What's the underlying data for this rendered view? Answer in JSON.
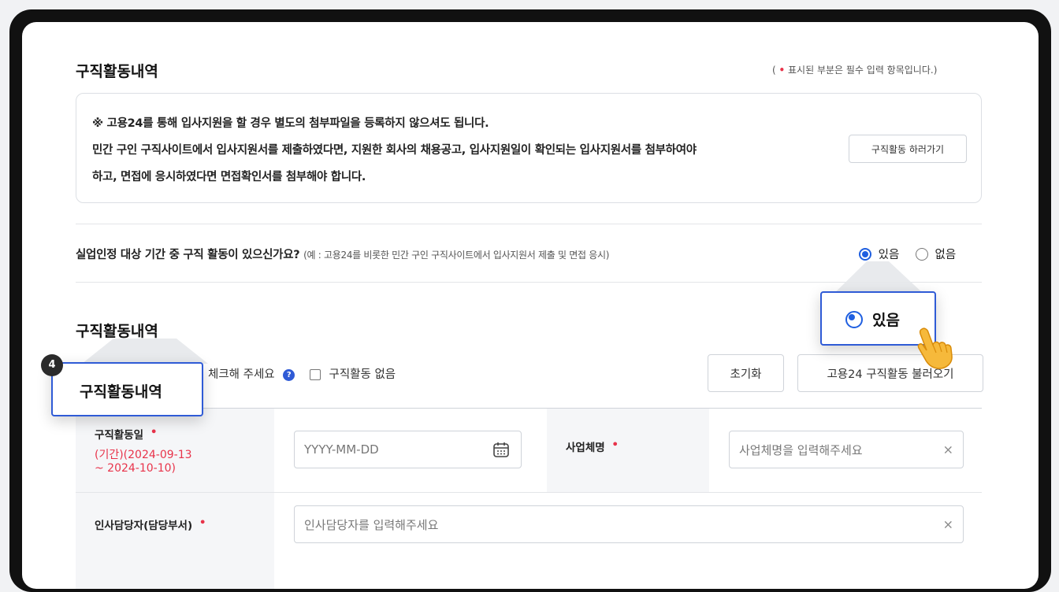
{
  "section": {
    "title": "구직활동내역",
    "required_note_before": "(",
    "required_note_after": "표시된 부분은 필수 입력 항목입니다.)",
    "required_mark": "•"
  },
  "notice": {
    "line1": "※ 고용24를 통해 입사지원을 할 경우 별도의 첨부파일을 등록하지 않으셔도 됩니다.",
    "line2": "민간 구인 구직사이트에서 입사지원서를 제출하였다면, 지원한 회사의 채용공고, 입사지원일이 확인되는 입사지원서를 첨부하여야",
    "line3": "하고, 면접에 응시하였다면 면접확인서를 첨부해야 합니다.",
    "go_button": "구직활동 하러가기"
  },
  "question": {
    "text": "실업인정 대상 기간 중 구직 활동이 있으신가요?",
    "example": "(예 : 고용24를 비롯한 민간 구인 구직사이트에서 입사지원서 제출 및 면접 응시)",
    "options": [
      {
        "label": "있음",
        "selected": true
      },
      {
        "label": "없음",
        "selected": false
      }
    ]
  },
  "activity": {
    "title": "구직활동내역",
    "check_text": "체크해 주세요",
    "help_mark": "?",
    "no_activity_label": "구직활동 없음",
    "reset_button": "초기화",
    "load_button": "고용24 구직활동 불러오기"
  },
  "form": {
    "date_label": "구직활동일",
    "date_period_line1": "(기간)(2024-09-13",
    "date_period_line2": "~ 2024-10-10)",
    "date_placeholder": "YYYY-MM-DD",
    "company_label": "사업체명",
    "company_placeholder": "사업체명을 입력해주세요",
    "hr_label": "인사담당자(담당부서)",
    "hr_placeholder": "인사담당자를 입력해주세요",
    "clear_icon": "×"
  },
  "callouts": {
    "radio_yes": "있음",
    "step_number": "4",
    "step_label": "구직활동내역"
  },
  "colors": {
    "accent": "#2f5bd6",
    "required": "#e8334a"
  }
}
